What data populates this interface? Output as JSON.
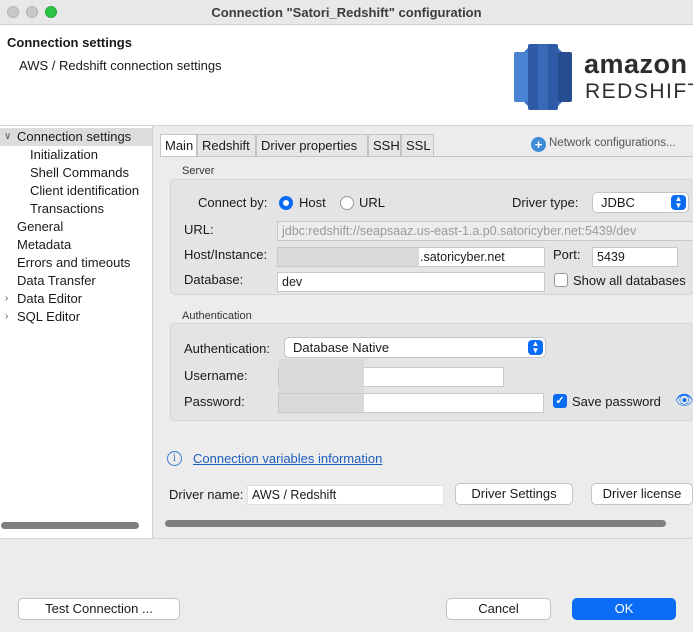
{
  "window": {
    "title": "Connection \"Satori_Redshift\" configuration"
  },
  "header": {
    "title": "Connection settings",
    "subtitle": "AWS / Redshift connection settings",
    "logo": {
      "line1": "amazon",
      "line2": "REDSHIFT"
    }
  },
  "sidebar": {
    "items": [
      {
        "label": "Connection settings",
        "expanded": true,
        "selected": true
      },
      {
        "label": "Initialization"
      },
      {
        "label": "Shell Commands"
      },
      {
        "label": "Client identification"
      },
      {
        "label": "Transactions"
      },
      {
        "label": "General"
      },
      {
        "label": "Metadata"
      },
      {
        "label": "Errors and timeouts"
      },
      {
        "label": "Data Transfer"
      },
      {
        "label": "Data Editor",
        "expandable": true
      },
      {
        "label": "SQL Editor",
        "expandable": true
      }
    ]
  },
  "tabs": [
    {
      "label": "Main",
      "active": true
    },
    {
      "label": "Redshift"
    },
    {
      "label": "Driver properties"
    },
    {
      "label": "SSH"
    },
    {
      "label": "SSL"
    }
  ],
  "network_link": "Network configurations...",
  "server": {
    "group_label": "Server",
    "connect_by_label": "Connect by:",
    "connect_by_options": [
      "Host",
      "URL"
    ],
    "connect_by_selected": "Host",
    "driver_type_label": "Driver type:",
    "driver_type_value": "JDBC",
    "url_label": "URL:",
    "url_value": "jdbc:redshift://seapsaaz.us-east-1.a.p0.satoricyber.net:5439/dev",
    "host_label": "Host/Instance:",
    "host_value": ".satoricyber.net",
    "port_label": "Port:",
    "port_value": "5439",
    "database_label": "Database:",
    "database_value": "dev",
    "show_all_label": "Show all databases",
    "show_all_checked": false
  },
  "auth": {
    "group_label": "Authentication",
    "auth_label": "Authentication:",
    "auth_value": "Database Native",
    "username_label": "Username:",
    "password_label": "Password:",
    "save_password_label": "Save password",
    "save_password_checked": true
  },
  "vars_link": "Connection variables information",
  "driver": {
    "name_label": "Driver name:",
    "name_value": "AWS / Redshift",
    "settings_button": "Driver Settings",
    "license_button": "Driver license"
  },
  "footer": {
    "test_button": "Test Connection ...",
    "cancel_button": "Cancel",
    "ok_button": "OK"
  },
  "colors": {
    "accent": "#0a6cf5",
    "link": "#1f5fbf",
    "logo_blue": "#2e5fa8"
  }
}
